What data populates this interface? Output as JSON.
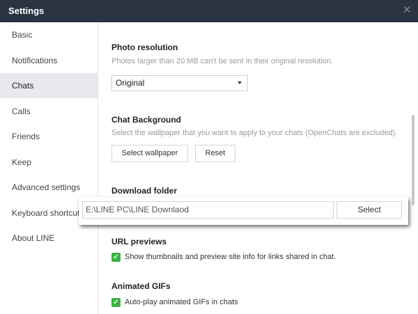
{
  "window": {
    "title": "Settings",
    "close_glyph": "✕"
  },
  "sidebar": {
    "items": [
      {
        "label": "Basic"
      },
      {
        "label": "Notifications"
      },
      {
        "label": "Chats"
      },
      {
        "label": "Calls"
      },
      {
        "label": "Friends"
      },
      {
        "label": "Keep"
      },
      {
        "label": "Advanced settings"
      },
      {
        "label": "Keyboard shortcuts"
      },
      {
        "label": "About LINE"
      }
    ],
    "active": "Chats"
  },
  "photo_resolution": {
    "title": "Photo resolution",
    "description": "Photos larger than 20 MB can't be sent in their original resolution.",
    "selected": "Original"
  },
  "chat_background": {
    "title": "Chat Background",
    "description": "Select the wallpaper that you want to apply to your chats (OpenChats are excluded).",
    "select_label": "Select wallpaper",
    "reset_label": "Reset"
  },
  "download_folder": {
    "title": "Download folder",
    "path": "E:\\LINE PC\\LINE Downlaod",
    "select_label": "Select"
  },
  "url_previews": {
    "title": "URL previews",
    "checkbox_label": "Show thumbnails and preview site info for links shared in chat.",
    "checked": true
  },
  "animated_gifs": {
    "title": "Animated GIFs",
    "checkbox_label": "Auto-play animated GIFs in chats",
    "checked": true
  },
  "colors": {
    "titlebar": "#2b3443",
    "active_item": "#e8e9ec",
    "checkbox": "#3cb43c"
  },
  "icons": {
    "close": "close-icon",
    "dropdown": "chevron-down-icon",
    "check": "check-icon"
  }
}
